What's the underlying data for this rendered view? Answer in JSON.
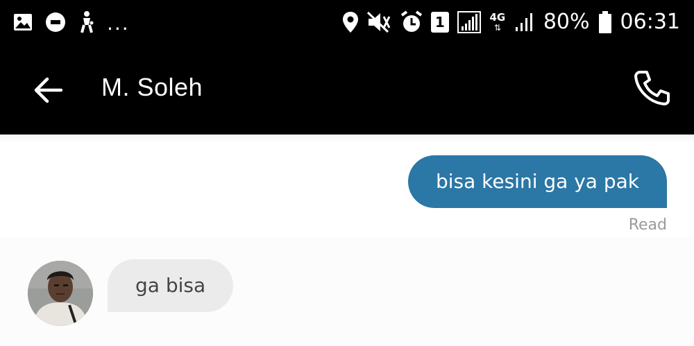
{
  "status_bar": {
    "left_icons": [
      "gallery-icon",
      "uber-app-icon",
      "accessibility-icon"
    ],
    "more_indicator": "...",
    "right_icons": [
      "location-icon",
      "mute-icon",
      "alarm-icon",
      "sim1-icon",
      "signal-icon",
      "4g-icon",
      "signal-weak-icon",
      "battery-icon"
    ],
    "sim_label": "1",
    "network_label": "4G",
    "battery_percent": "80%",
    "time": "06:31"
  },
  "app_bar": {
    "back_icon": "arrow-left-icon",
    "contact_name": "M. Soleh",
    "call_icon": "phone-icon"
  },
  "messages": [
    {
      "direction": "outgoing",
      "text": "bisa kesini ga ya pak",
      "status": "Read"
    },
    {
      "direction": "incoming",
      "text": "ga bisa",
      "avatar": "avatar"
    }
  ],
  "colors": {
    "header_bg": "#000000",
    "outgoing_bubble": "#2b77a6",
    "incoming_bubble": "#ebebeb",
    "read_text": "#9a9a9a"
  }
}
